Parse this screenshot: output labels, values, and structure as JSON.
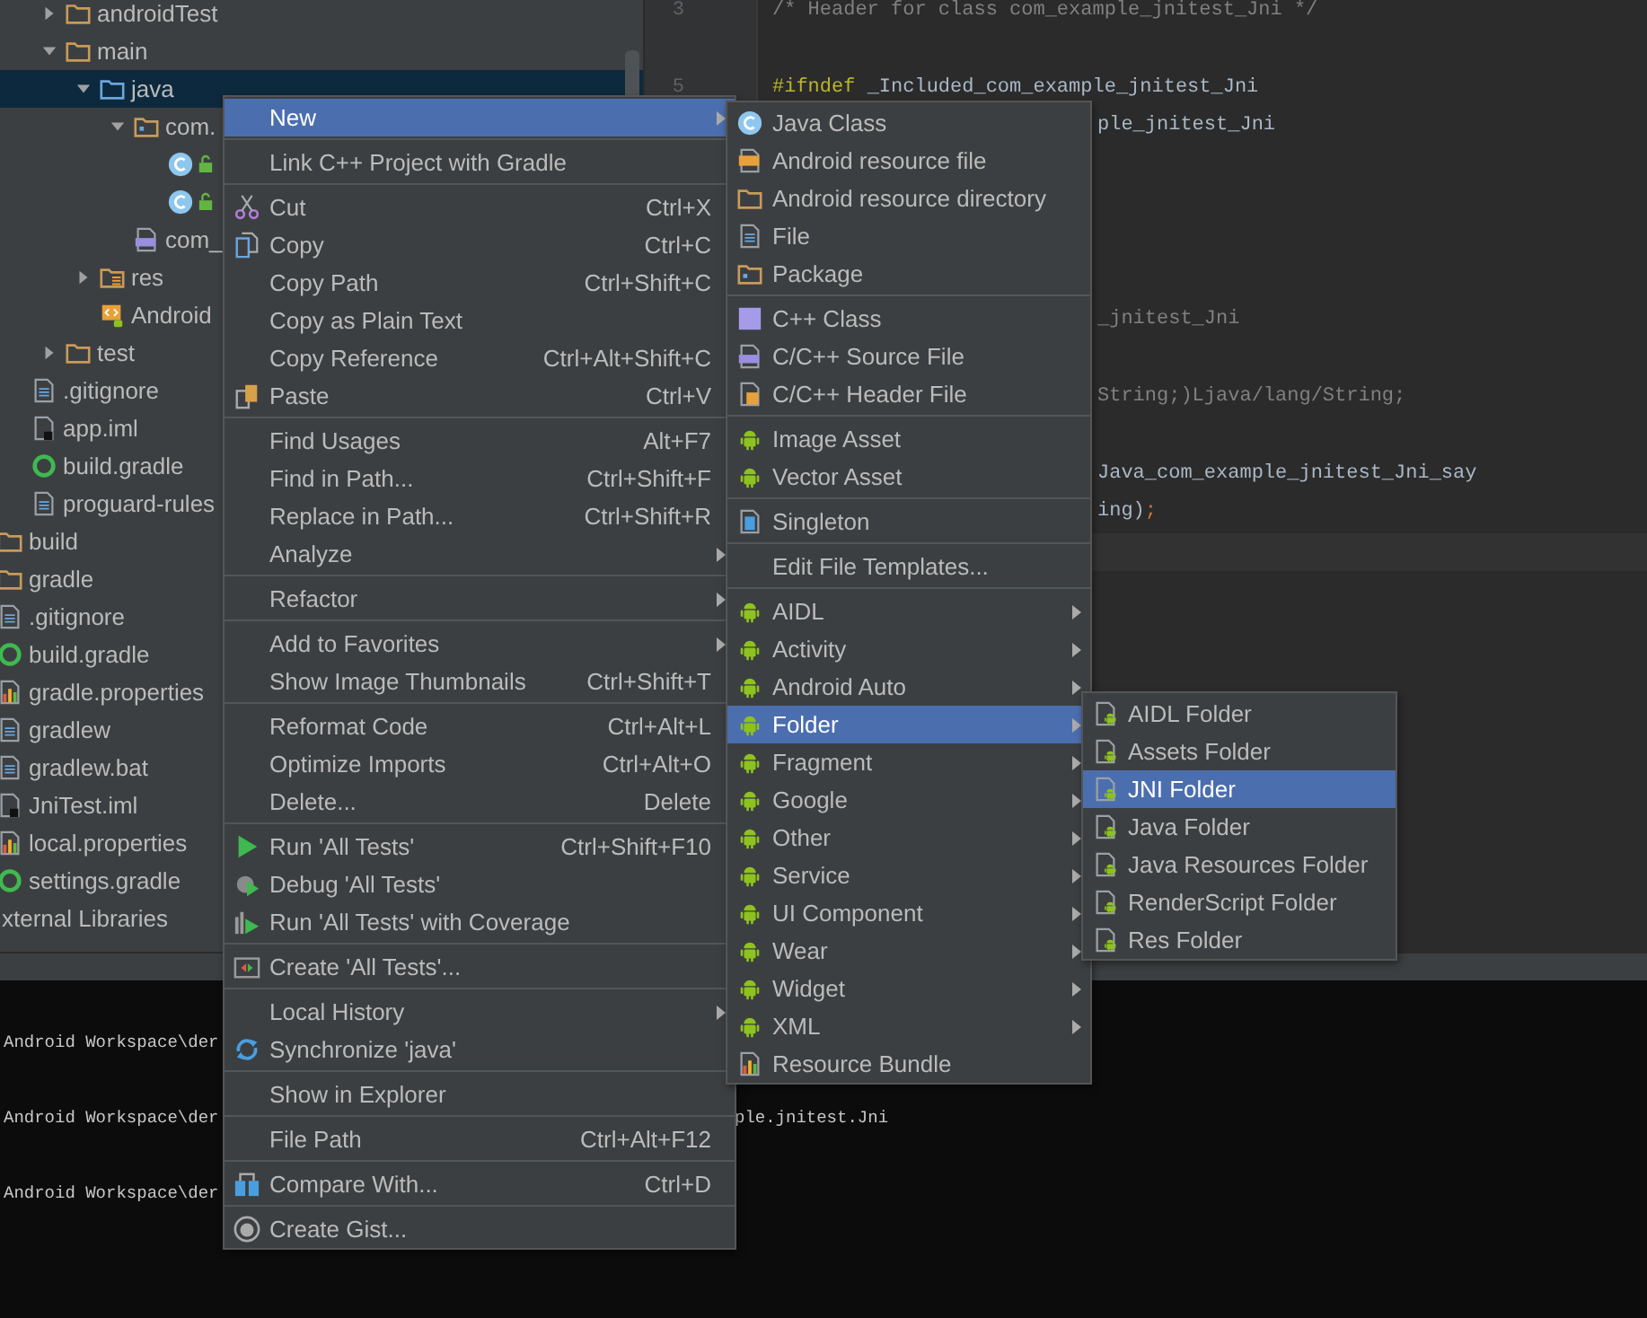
{
  "project_tree": [
    {
      "children": [
        {
          "children": [
            {
              "children": [
                {
                  "label": "androidTest",
                  "kind": "folder",
                  "expanded": false,
                  "selected": false
                },
                {
                  "label": "main",
                  "kind": "folder",
                  "expanded": true,
                  "selected": false,
                  "children": [
                    {
                      "label": "java",
                      "kind": "source-folder",
                      "expanded": true,
                      "selected": true,
                      "children": [
                        {
                          "label": "com.",
                          "kind": "package",
                          "expanded": true,
                          "selected": false,
                          "children": [
                            {
                              "kind": "class",
                              "selected": false
                            },
                            {
                              "kind": "class",
                              "selected": false
                            }
                          ]
                        },
                        {
                          "label": "com_",
                          "kind": "cpp-file",
                          "selected": false
                        }
                      ]
                    },
                    {
                      "label": "res",
                      "kind": "res-folder",
                      "expanded": false,
                      "selected": false
                    },
                    {
                      "label": "Android",
                      "kind": "manifest",
                      "selected": false
                    }
                  ]
                },
                {
                  "label": "test",
                  "kind": "folder",
                  "expanded": false,
                  "selected": false
                }
              ]
            },
            {
              "label": ".gitignore",
              "kind": "text-file",
              "selected": false
            },
            {
              "label": "app.iml",
              "kind": "module",
              "selected": false
            },
            {
              "label": "build.gradle",
              "kind": "gradle",
              "selected": false
            },
            {
              "label": "proguard-rules",
              "kind": "text-file",
              "selected": false
            }
          ]
        },
        {
          "label": "build",
          "kind": "folder",
          "selected": false
        },
        {
          "label": "gradle",
          "kind": "folder",
          "selected": false
        },
        {
          "label": ".gitignore",
          "kind": "text-file",
          "selected": false
        },
        {
          "label": "build.gradle",
          "kind": "gradle",
          "selected": false
        },
        {
          "label": "gradle.properties",
          "kind": "properties",
          "selected": false
        },
        {
          "label": "gradlew",
          "kind": "text-file",
          "selected": false
        },
        {
          "label": "gradlew.bat",
          "kind": "text-file",
          "selected": false
        },
        {
          "label": "JniTest.iml",
          "kind": "module",
          "selected": false
        },
        {
          "label": "local.properties",
          "kind": "properties",
          "selected": false
        },
        {
          "label": "settings.gradle",
          "kind": "gradle",
          "selected": false
        }
      ]
    },
    {
      "label": "xternal Libraries",
      "selected": false
    }
  ],
  "editor": {
    "lines": [
      {
        "kind": "code",
        "number": "3",
        "parts": [
          {
            "text": "/* Header for class com_example_jnitest_Jni */",
            "kind": "comment"
          }
        ]
      },
      {
        "kind": "blank"
      },
      {
        "kind": "code",
        "number": "5",
        "parts": [
          {
            "text": "#ifndef",
            "kind": "directive"
          },
          {
            "text": " _Included_com_example_jnitest_Jni",
            "kind": "plain"
          }
        ]
      },
      {
        "kind": "fragment",
        "parts": [
          {
            "text": "ple_jnitest_Jni",
            "kind": "plain"
          }
        ]
      },
      {
        "kind": "blank"
      },
      {
        "kind": "blank"
      },
      {
        "kind": "blank"
      },
      {
        "kind": "blank"
      },
      {
        "kind": "fragment",
        "parts": [
          {
            "text": "_jnitest_Jni",
            "kind": "comment"
          }
        ]
      },
      {
        "kind": "blank"
      },
      {
        "kind": "fragment",
        "parts": [
          {
            "text": "String;)Ljava/lang/String;",
            "kind": "comment"
          }
        ]
      },
      {
        "kind": "blank"
      },
      {
        "kind": "fragment",
        "parts": [
          {
            "text": "Java_com_example_jnitest_Jni_say",
            "kind": "plain"
          }
        ]
      },
      {
        "kind": "fragment",
        "parts": [
          {
            "text": "ing)",
            "kind": "plain"
          },
          {
            "text": ";",
            "kind": "punct"
          }
        ]
      },
      {
        "kind": "current"
      }
    ]
  },
  "terminal": {
    "lines": [
      {
        "kind": "blank"
      },
      {
        "kind": "text",
        "text": "Android Workspace\\der"
      },
      {
        "kind": "blank"
      },
      {
        "kind": "text",
        "text": "Android Workspace\\der",
        "tail": "ple.jnitest.Jni"
      },
      {
        "kind": "blank"
      },
      {
        "kind": "text",
        "text": "Android Workspace\\der"
      }
    ]
  },
  "context_menu": {
    "items": [
      {
        "kind": "plain",
        "label": "New",
        "submenu": true,
        "selected": true
      },
      {
        "kind": "separator"
      },
      {
        "kind": "plain",
        "label": "Link C++ Project with Gradle",
        "selected": false
      },
      {
        "kind": "separator"
      },
      {
        "kind": "cut",
        "label": "Cut",
        "shortcut": "Ctrl+X",
        "selected": false
      },
      {
        "kind": "copy",
        "label": "Copy",
        "shortcut": "Ctrl+C",
        "selected": false
      },
      {
        "kind": "plain",
        "label": "Copy Path",
        "shortcut": "Ctrl+Shift+C",
        "selected": false
      },
      {
        "kind": "plain",
        "label": "Copy as Plain Text",
        "selected": false
      },
      {
        "kind": "plain",
        "label": "Copy Reference",
        "shortcut": "Ctrl+Alt+Shift+C",
        "selected": false
      },
      {
        "kind": "paste",
        "label": "Paste",
        "shortcut": "Ctrl+V",
        "selected": false
      },
      {
        "kind": "separator"
      },
      {
        "kind": "plain",
        "label": "Find Usages",
        "shortcut": "Alt+F7",
        "selected": false
      },
      {
        "kind": "plain",
        "label": "Find in Path...",
        "shortcut": "Ctrl+Shift+F",
        "selected": false
      },
      {
        "kind": "plain",
        "label": "Replace in Path...",
        "shortcut": "Ctrl+Shift+R",
        "selected": false
      },
      {
        "kind": "plain",
        "label": "Analyze",
        "submenu": true,
        "selected": false
      },
      {
        "kind": "separator"
      },
      {
        "kind": "plain",
        "label": "Refactor",
        "submenu": true,
        "selected": false
      },
      {
        "kind": "separator"
      },
      {
        "kind": "plain",
        "label": "Add to Favorites",
        "submenu": true,
        "selected": false
      },
      {
        "kind": "plain",
        "label": "Show Image Thumbnails",
        "shortcut": "Ctrl+Shift+T",
        "selected": false
      },
      {
        "kind": "separator"
      },
      {
        "kind": "plain",
        "label": "Reformat Code",
        "shortcut": "Ctrl+Alt+L",
        "selected": false
      },
      {
        "kind": "plain",
        "label": "Optimize Imports",
        "shortcut": "Ctrl+Alt+O",
        "selected": false
      },
      {
        "kind": "plain",
        "label": "Delete...",
        "shortcut": "Delete",
        "selected": false
      },
      {
        "kind": "separator"
      },
      {
        "kind": "run",
        "label": "Run 'All Tests'",
        "shortcut": "Ctrl+Shift+F10",
        "selected": false
      },
      {
        "kind": "debug",
        "label": "Debug 'All Tests'",
        "selected": false
      },
      {
        "kind": "coverage",
        "label": "Run 'All Tests' with Coverage",
        "selected": false
      },
      {
        "kind": "separator"
      },
      {
        "kind": "create-test",
        "label": "Create 'All Tests'...",
        "selected": false
      },
      {
        "kind": "separator"
      },
      {
        "kind": "plain",
        "label": "Local History",
        "submenu": true,
        "selected": false
      },
      {
        "kind": "sync",
        "label": "Synchronize 'java'",
        "selected": false
      },
      {
        "kind": "separator"
      },
      {
        "kind": "plain",
        "label": "Show in Explorer",
        "selected": false
      },
      {
        "kind": "separator"
      },
      {
        "kind": "plain",
        "label": "File Path",
        "shortcut": "Ctrl+Alt+F12",
        "selected": false
      },
      {
        "kind": "separator"
      },
      {
        "kind": "compare",
        "label": "Compare With...",
        "shortcut": "Ctrl+D",
        "selected": false
      },
      {
        "kind": "separator"
      },
      {
        "kind": "gist",
        "label": "Create Gist...",
        "selected": false
      }
    ]
  },
  "new_submenu": {
    "items": [
      {
        "kind": "java-class",
        "label": "Java Class",
        "selected": false
      },
      {
        "kind": "resource-file",
        "label": "Android resource file",
        "selected": false
      },
      {
        "kind": "resource-dir",
        "label": "Android resource directory",
        "selected": false
      },
      {
        "kind": "file",
        "label": "File",
        "selected": false
      },
      {
        "kind": "package",
        "label": "Package",
        "selected": false
      },
      {
        "kind": "separator"
      },
      {
        "kind": "cpp-class",
        "label": "C++ Class",
        "selected": false
      },
      {
        "kind": "cpp-source",
        "label": "C/C++ Source File",
        "selected": false
      },
      {
        "kind": "cpp-header",
        "label": "C/C++ Header File",
        "selected": false
      },
      {
        "kind": "separator"
      },
      {
        "kind": "android",
        "label": "Image Asset",
        "selected": false
      },
      {
        "kind": "android",
        "label": "Vector Asset",
        "selected": false
      },
      {
        "kind": "separator"
      },
      {
        "kind": "singleton",
        "label": "Singleton",
        "selected": false
      },
      {
        "kind": "separator"
      },
      {
        "kind": "plain",
        "label": "Edit File Templates...",
        "selected": false
      },
      {
        "kind": "separator"
      },
      {
        "kind": "android",
        "label": "AIDL",
        "submenu": true,
        "selected": false
      },
      {
        "kind": "android",
        "label": "Activity",
        "submenu": true,
        "selected": false
      },
      {
        "kind": "android",
        "label": "Android Auto",
        "submenu": true,
        "selected": false
      },
      {
        "kind": "android",
        "label": "Folder",
        "submenu": true,
        "selected": true
      },
      {
        "kind": "android",
        "label": "Fragment",
        "submenu": true,
        "selected": false
      },
      {
        "kind": "android",
        "label": "Google",
        "submenu": true,
        "selected": false
      },
      {
        "kind": "android",
        "label": "Other",
        "submenu": true,
        "selected": false
      },
      {
        "kind": "android",
        "label": "Service",
        "submenu": true,
        "selected": false
      },
      {
        "kind": "android",
        "label": "UI Component",
        "submenu": true,
        "selected": false
      },
      {
        "kind": "android",
        "label": "Wear",
        "submenu": true,
        "selected": false
      },
      {
        "kind": "android",
        "label": "Widget",
        "submenu": true,
        "selected": false
      },
      {
        "kind": "android",
        "label": "XML",
        "submenu": true,
        "selected": false
      },
      {
        "kind": "bundle",
        "label": "Resource Bundle",
        "selected": false
      }
    ]
  },
  "folder_submenu": {
    "items": [
      {
        "kind": "android-folder",
        "label": "AIDL Folder",
        "selected": false
      },
      {
        "kind": "android-folder",
        "label": "Assets Folder",
        "selected": false
      },
      {
        "kind": "android-folder",
        "label": "JNI Folder",
        "selected": true
      },
      {
        "kind": "android-folder",
        "label": "Java Folder",
        "selected": false
      },
      {
        "kind": "android-folder",
        "label": "Java Resources Folder",
        "selected": false
      },
      {
        "kind": "android-folder",
        "label": "RenderScript Folder",
        "selected": false
      },
      {
        "kind": "android-folder",
        "label": "Res Folder",
        "selected": false
      }
    ]
  }
}
